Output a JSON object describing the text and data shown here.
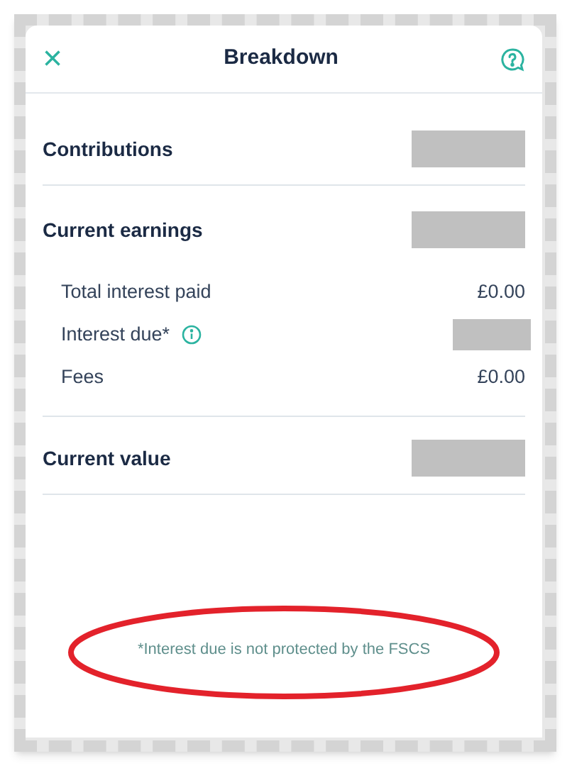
{
  "header": {
    "close": "×",
    "title": "Breakdown"
  },
  "rows": [
    {
      "kind": "section",
      "label": "Contributions",
      "redacted": true,
      "divider_after": true
    },
    {
      "kind": "section",
      "label": "Current earnings",
      "redacted": true
    },
    {
      "kind": "detail",
      "label": "Total interest paid",
      "value": "£0.00"
    },
    {
      "kind": "detail",
      "label": "Interest due*",
      "info": true,
      "redacted": true
    },
    {
      "kind": "detail",
      "label": "Fees",
      "value": "£0.00",
      "divider_after": true
    },
    {
      "kind": "section",
      "label": "Current value",
      "redacted": true,
      "divider_after": true
    }
  ],
  "footnote": "*Interest due is not protected by the FSCS",
  "annotation": {
    "kind": "ellipse",
    "color": "#e3222b"
  }
}
